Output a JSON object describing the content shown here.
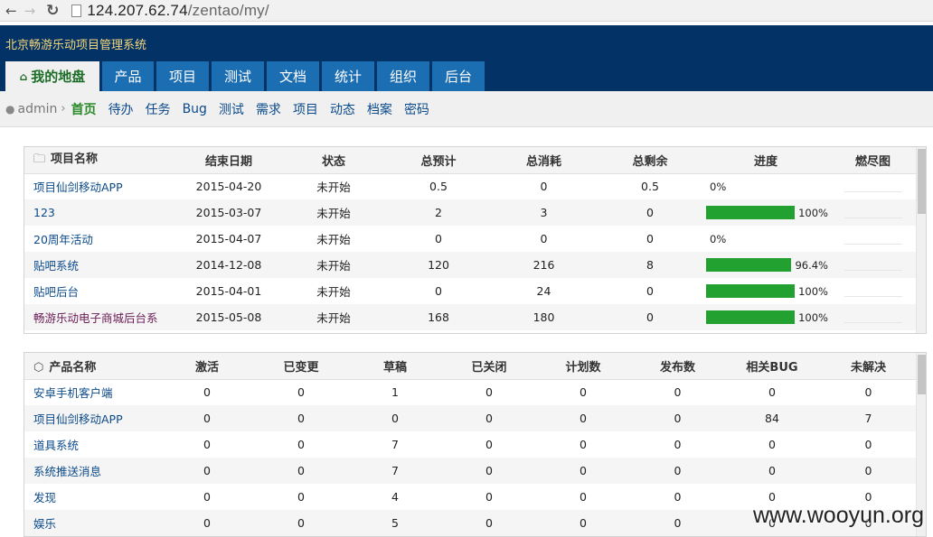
{
  "browser": {
    "url_host": "124.207.62.74",
    "url_path": "/zentao/my/"
  },
  "header": {
    "system_title": "北京畅游乐动项目管理系统"
  },
  "tabs": [
    {
      "label": "我的地盘",
      "icon": "home-icon",
      "active": true
    },
    {
      "label": "产品"
    },
    {
      "label": "项目"
    },
    {
      "label": "测试"
    },
    {
      "label": "文档"
    },
    {
      "label": "统计"
    },
    {
      "label": "组织"
    },
    {
      "label": "后台"
    }
  ],
  "subnav": {
    "user": "admin",
    "items": [
      {
        "label": "首页",
        "active": true
      },
      {
        "label": "待办"
      },
      {
        "label": "任务"
      },
      {
        "label": "Bug"
      },
      {
        "label": "测试"
      },
      {
        "label": "需求"
      },
      {
        "label": "项目"
      },
      {
        "label": "动态"
      },
      {
        "label": "档案"
      },
      {
        "label": "密码"
      }
    ]
  },
  "projects": {
    "headers": [
      "项目名称",
      "结束日期",
      "状态",
      "总预计",
      "总消耗",
      "总剩余",
      "进度",
      "燃尽图"
    ],
    "rows": [
      {
        "name": "项目仙剑移动APP",
        "end": "2015-04-20",
        "status": "未开始",
        "estimate": "0.5",
        "consumed": "0",
        "left": "0.5",
        "progress": 0,
        "progress_label": "0%"
      },
      {
        "name": "123",
        "end": "2015-03-07",
        "status": "未开始",
        "estimate": "2",
        "consumed": "3",
        "left": "0",
        "progress": 100,
        "progress_label": "100%"
      },
      {
        "name": "20周年活动",
        "end": "2015-04-07",
        "status": "未开始",
        "estimate": "0",
        "consumed": "0",
        "left": "0",
        "progress": 0,
        "progress_label": "0%"
      },
      {
        "name": "贴吧系统",
        "end": "2014-12-08",
        "status": "未开始",
        "estimate": "120",
        "consumed": "216",
        "left": "8",
        "progress": 96.4,
        "progress_label": "96.4%"
      },
      {
        "name": "贴吧后台",
        "end": "2015-04-01",
        "status": "未开始",
        "estimate": "0",
        "consumed": "24",
        "left": "0",
        "progress": 100,
        "progress_label": "100%"
      },
      {
        "name": "畅游乐动电子商城后台系",
        "end": "2015-05-08",
        "status": "未开始",
        "estimate": "168",
        "consumed": "180",
        "left": "0",
        "progress": 100,
        "progress_label": "100%"
      }
    ]
  },
  "products": {
    "headers": [
      "产品名称",
      "激活",
      "已变更",
      "草稿",
      "已关闭",
      "计划数",
      "发布数",
      "相关BUG",
      "未解决"
    ],
    "rows": [
      {
        "name": "安卓手机客户端",
        "vals": [
          "0",
          "0",
          "1",
          "0",
          "0",
          "0",
          "0",
          "0"
        ]
      },
      {
        "name": "项目仙剑移动APP",
        "vals": [
          "0",
          "0",
          "0",
          "0",
          "0",
          "0",
          "84",
          "7"
        ]
      },
      {
        "name": "道具系统",
        "vals": [
          "0",
          "0",
          "7",
          "0",
          "0",
          "0",
          "0",
          "0"
        ]
      },
      {
        "name": "系统推送消息",
        "vals": [
          "0",
          "0",
          "7",
          "0",
          "0",
          "0",
          "0",
          "0"
        ]
      },
      {
        "name": "发现",
        "vals": [
          "0",
          "0",
          "4",
          "0",
          "0",
          "0",
          "0",
          "0"
        ]
      },
      {
        "name": "娱乐",
        "vals": [
          "0",
          "0",
          "5",
          "0",
          "0",
          "0",
          "0",
          "0"
        ]
      }
    ]
  },
  "colors": {
    "header_bg": "#033266",
    "tab_bg": "#1c6eb3",
    "progress_green": "#22a030",
    "link_blue": "#0b4a8a"
  },
  "watermark": "www.wooyun.org"
}
